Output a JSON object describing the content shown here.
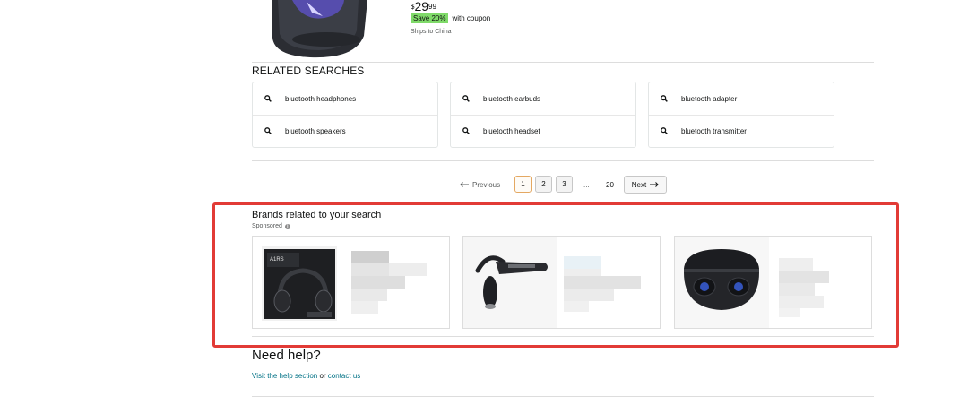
{
  "product": {
    "price_currency": "$",
    "price_whole": "29",
    "price_fraction": "99",
    "coupon_badge": "Save 20%",
    "coupon_suffix": "with coupon",
    "shipping": "Ships to China"
  },
  "related_searches": {
    "title": "RELATED SEARCHES",
    "columns": [
      [
        "bluetooth headphones",
        "bluetooth speakers"
      ],
      [
        "bluetooth earbuds",
        "bluetooth headset"
      ],
      [
        "bluetooth adapter",
        "bluetooth transmitter"
      ]
    ]
  },
  "pagination": {
    "previous": "Previous",
    "pages": [
      "1",
      "2",
      "3"
    ],
    "ellipsis": "...",
    "last": "20",
    "next": "Next",
    "current": "1"
  },
  "brands": {
    "title": "Brands related to your search",
    "sponsored": "Sponsored",
    "info": "i",
    "cards": [
      {
        "image": "headphones-box"
      },
      {
        "image": "bluetooth-headset"
      },
      {
        "image": "earbuds-case"
      }
    ]
  },
  "help": {
    "title": "Need help?",
    "visit_link": "Visit the help section",
    "or_text": " or ",
    "contact_link": "contact us"
  },
  "colors": {
    "highlight": "#e23b36",
    "link": "#007185",
    "coupon": "#7fda69"
  }
}
